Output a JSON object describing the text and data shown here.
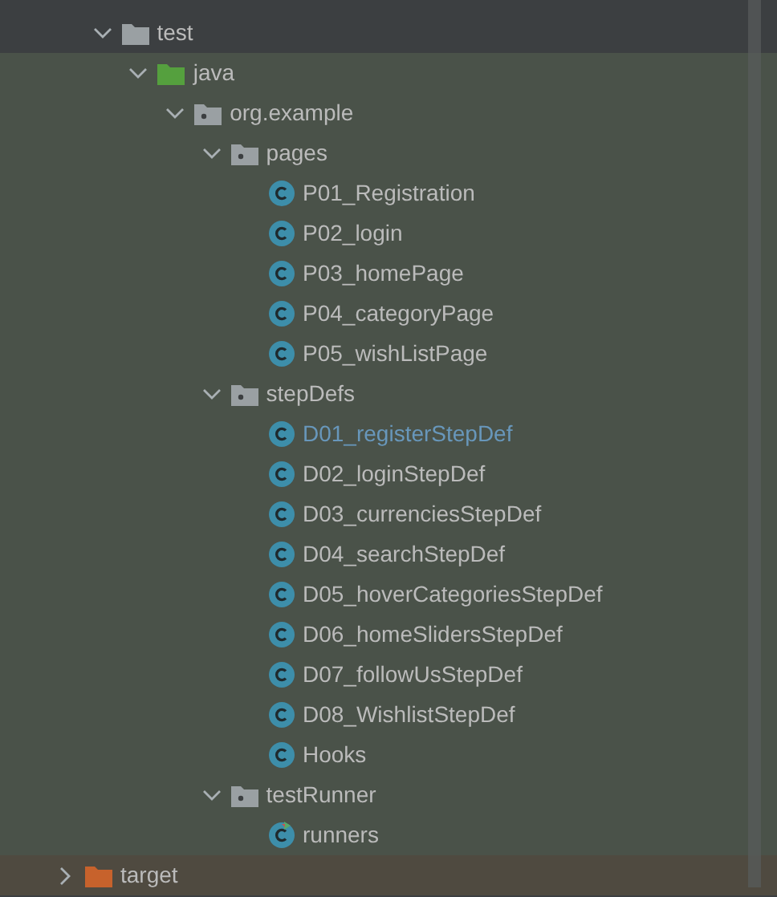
{
  "tree": [
    {
      "label": "test",
      "kind": "folder",
      "expanded": true,
      "test_scope": false,
      "children": [
        {
          "label": "java",
          "kind": "source_root",
          "expanded": true,
          "test_scope": true,
          "children": [
            {
              "label": "org.example",
              "kind": "package",
              "expanded": true,
              "test_scope": true,
              "children": [
                {
                  "label": "pages",
                  "kind": "package",
                  "expanded": true,
                  "test_scope": true,
                  "children": [
                    {
                      "label": "P01_Registration",
                      "kind": "class",
                      "modified": false,
                      "test_scope": true
                    },
                    {
                      "label": "P02_login",
                      "kind": "class",
                      "modified": false,
                      "test_scope": true
                    },
                    {
                      "label": "P03_homePage",
                      "kind": "class",
                      "modified": false,
                      "test_scope": true
                    },
                    {
                      "label": "P04_categoryPage",
                      "kind": "class",
                      "modified": false,
                      "test_scope": true
                    },
                    {
                      "label": "P05_wishListPage",
                      "kind": "class",
                      "modified": false,
                      "test_scope": true
                    }
                  ]
                },
                {
                  "label": "stepDefs",
                  "kind": "package",
                  "expanded": true,
                  "test_scope": true,
                  "children": [
                    {
                      "label": "D01_registerStepDef",
                      "kind": "class",
                      "modified": true,
                      "test_scope": true
                    },
                    {
                      "label": "D02_loginStepDef",
                      "kind": "class",
                      "modified": false,
                      "test_scope": true
                    },
                    {
                      "label": "D03_currenciesStepDef",
                      "kind": "class",
                      "modified": false,
                      "test_scope": true
                    },
                    {
                      "label": "D04_searchStepDef",
                      "kind": "class",
                      "modified": false,
                      "test_scope": true
                    },
                    {
                      "label": "D05_hoverCategoriesStepDef",
                      "kind": "class",
                      "modified": false,
                      "test_scope": true
                    },
                    {
                      "label": "D06_homeSlidersStepDef",
                      "kind": "class",
                      "modified": false,
                      "test_scope": true
                    },
                    {
                      "label": "D07_followUsStepDef",
                      "kind": "class",
                      "modified": false,
                      "test_scope": true
                    },
                    {
                      "label": "D08_WishlistStepDef",
                      "kind": "class",
                      "modified": false,
                      "test_scope": true
                    },
                    {
                      "label": "Hooks",
                      "kind": "class",
                      "modified": false,
                      "test_scope": true
                    }
                  ]
                },
                {
                  "label": "testRunner",
                  "kind": "package",
                  "expanded": true,
                  "test_scope": true,
                  "children": [
                    {
                      "label": "runners",
                      "kind": "runner_class",
                      "modified": false,
                      "test_scope": true
                    }
                  ]
                }
              ]
            }
          ]
        }
      ]
    },
    {
      "label": "target",
      "kind": "excluded",
      "expanded": false
    }
  ]
}
